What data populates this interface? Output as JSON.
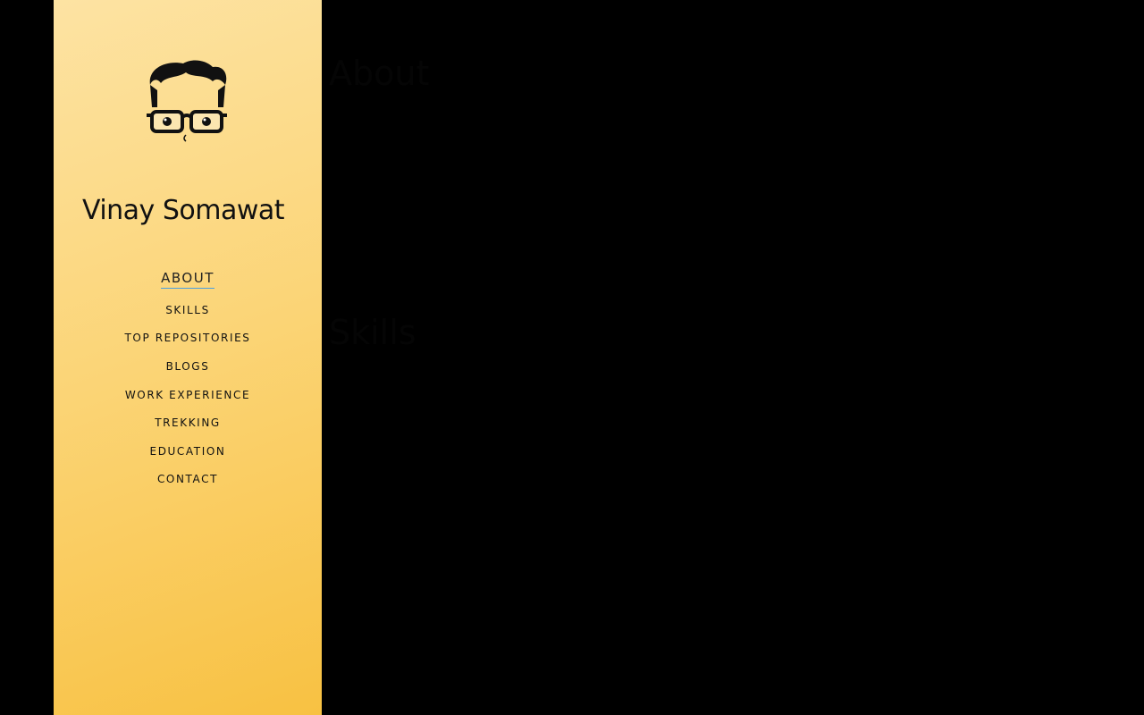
{
  "sidebar": {
    "name": "Vinay Somawat",
    "nav": [
      {
        "label": "ABOUT",
        "active": true
      },
      {
        "label": "SKILLS",
        "active": false
      },
      {
        "label": "TOP REPOSITORIES",
        "active": false
      },
      {
        "label": "BLOGS",
        "active": false
      },
      {
        "label": "WORK EXPERIENCE",
        "active": false
      },
      {
        "label": "TREKKING",
        "active": false
      },
      {
        "label": "EDUCATION",
        "active": false
      },
      {
        "label": "CONTACT",
        "active": false
      }
    ],
    "accent_color": "#4a9fe0",
    "gradient_start": "#fde3a3",
    "gradient_end": "#f8c142",
    "avatar_icon": "cartoon-face-with-glasses-icon"
  },
  "main": {
    "about_heading": "About",
    "skills_heading": "Skills"
  }
}
